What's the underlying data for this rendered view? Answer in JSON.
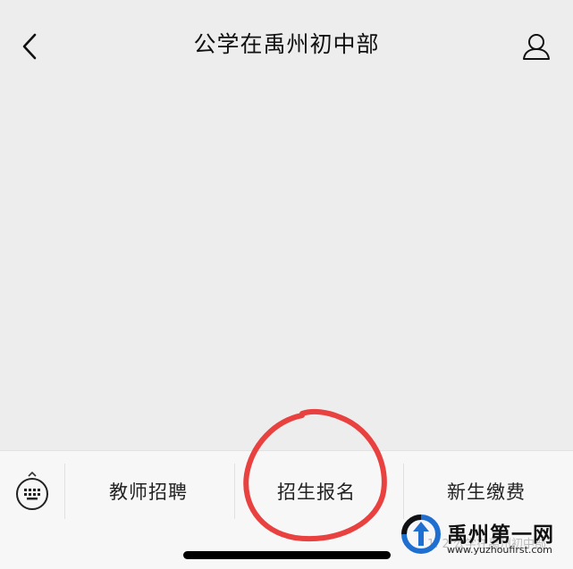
{
  "header": {
    "title": "公学在禹州初中部",
    "back_icon": "chevron-left-icon",
    "profile_icon": "person-outline-icon"
  },
  "menu": {
    "keyboard_icon": "keyboard-icon",
    "items": [
      {
        "label": "教师招聘"
      },
      {
        "label": "招生报名"
      },
      {
        "label": "新生缴费"
      }
    ],
    "highlighted_item": "招生报名",
    "highlight_color": "#e8413f"
  },
  "watermark": {
    "name": "禹州第一网",
    "url": "www.yuzhoufirst.com",
    "faint_text": "1. 2 公学在禹州初中部",
    "logo_colors": [
      "#1f6fd0",
      "#111111"
    ]
  },
  "colors": {
    "page_bg": "#ededed",
    "bar_bg": "#f7f7f7"
  }
}
